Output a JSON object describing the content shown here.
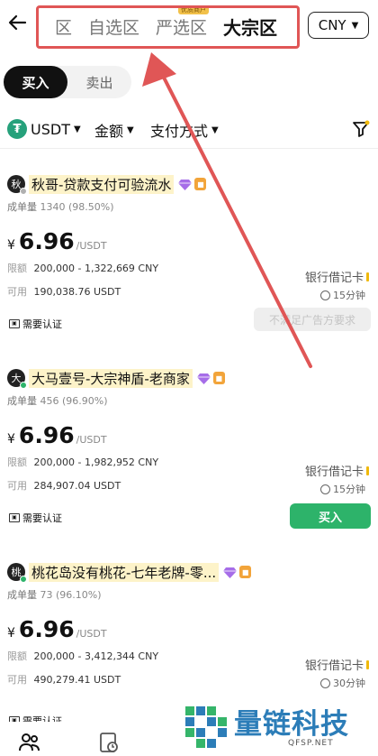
{
  "header": {
    "back_icon": "back-arrow-icon",
    "tabs": [
      {
        "label": "区"
      },
      {
        "label": "自选区"
      },
      {
        "label": "严选区",
        "badge": "优质商户"
      },
      {
        "label": "大宗区"
      }
    ],
    "active_tab": "大宗区",
    "currency": "CNY"
  },
  "toggle": {
    "buy": "买入",
    "sell": "卖出",
    "active": "买入"
  },
  "filters": {
    "coin": "USDT",
    "amount": "金额",
    "payment": "支付方式",
    "filter_icon": "funnel-icon"
  },
  "cards": [
    {
      "avatar": "秋",
      "avatar_dot_color": "#b0b0b0",
      "name": "秋哥-贷款支付可验流水",
      "orders_label": "成单量",
      "orders_value": "1340 (98.50%)",
      "currency_symbol": "¥",
      "price": "6.96",
      "price_unit": "/USDT",
      "limit_label": "限额",
      "limit_value": "200,000 - 1,322,669 CNY",
      "avail_label": "可用",
      "avail_value": "190,038.76 USDT",
      "payment": "银行借记卡",
      "time": "15分钟",
      "cert": "需要认证",
      "action": "不满足广告方要求",
      "action_enabled": false
    },
    {
      "avatar": "大",
      "avatar_dot_color": "#2db36a",
      "name": "大马壹号-大宗神盾-老商家",
      "orders_label": "成单量",
      "orders_value": "456 (96.90%)",
      "currency_symbol": "¥",
      "price": "6.96",
      "price_unit": "/USDT",
      "limit_label": "限额",
      "limit_value": "200,000 - 1,982,952 CNY",
      "avail_label": "可用",
      "avail_value": "284,907.04 USDT",
      "payment": "银行借记卡",
      "time": "15分钟",
      "cert": "需要认证",
      "action": "买入",
      "action_enabled": true
    },
    {
      "avatar": "桃",
      "avatar_dot_color": "#2db36a",
      "name": "桃花岛没有桃花-七年老牌-零...",
      "orders_label": "成单量",
      "orders_value": "73 (96.10%)",
      "currency_symbol": "¥",
      "price": "6.96",
      "price_unit": "/USDT",
      "limit_label": "限额",
      "limit_value": "200,000 - 3,412,344 CNY",
      "avail_label": "可用",
      "avail_value": "490,279.41 USDT",
      "payment": "银行借记卡",
      "time": "30分钟",
      "cert": "需要认证"
    }
  ],
  "watermark": {
    "text": "量链科技",
    "url": "QFSP.NET"
  },
  "colors": {
    "accent_green": "#2db36a",
    "annotation_red": "#e05656",
    "usdt_green": "#26a17b"
  }
}
